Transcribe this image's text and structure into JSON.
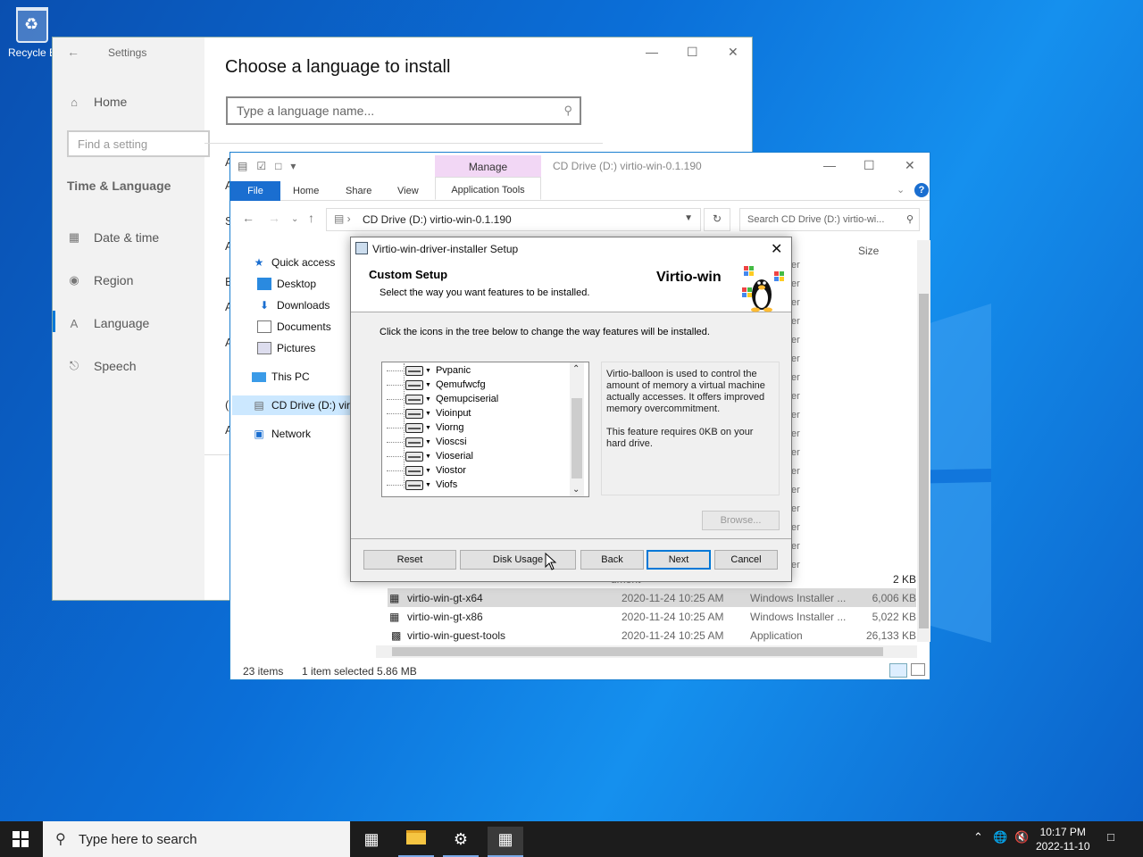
{
  "desktop": {
    "recycle_label": "Recycle B"
  },
  "settings": {
    "title": "Settings",
    "nav": {
      "home": "Home",
      "find_placeholder": "Find a setting",
      "section": "Time & Language",
      "items": [
        "Date & time",
        "Region",
        "Language",
        "Speech"
      ]
    },
    "page_title": "Choose a language to install",
    "search_placeholder": "Type a language name...",
    "edge_letters": [
      "A",
      "A",
      "S",
      "A",
      "E",
      "A",
      "A",
      "(",
      "A"
    ]
  },
  "explorer": {
    "title_path": "CD Drive (D:) virtio-win-0.1.190",
    "manage_label": "Manage",
    "app_tools_label": "Application Tools",
    "tabs": {
      "file": "File",
      "home": "Home",
      "share": "Share",
      "view": "View"
    },
    "address": "CD Drive (D:) virtio-win-0.1.190",
    "search_placeholder": "Search CD Drive (D:) virtio-wi...",
    "nav_tree": [
      {
        "label": "Quick access",
        "icon": "star-icon"
      },
      {
        "label": "Desktop",
        "icon": "desktop-folder-icon"
      },
      {
        "label": "Downloads",
        "icon": "downloads-icon"
      },
      {
        "label": "Documents",
        "icon": "documents-icon"
      },
      {
        "label": "Pictures",
        "icon": "pictures-icon"
      },
      {
        "label": "This PC",
        "icon": "pc-icon"
      },
      {
        "label": "CD Drive (D:) virt",
        "icon": "cd-drive-icon"
      },
      {
        "label": "Network",
        "icon": "network-icon"
      }
    ],
    "column_size": "Size",
    "partial_type_suffix": "er",
    "files": [
      {
        "name": "",
        "date": "",
        "type": "ument",
        "size": "2 KB"
      },
      {
        "name": "virtio-win-gt-x64",
        "date": "2020-11-24 10:25 AM",
        "type": "Windows Installer ...",
        "size": "6,006 KB"
      },
      {
        "name": "virtio-win-gt-x86",
        "date": "2020-11-24 10:25 AM",
        "type": "Windows Installer ...",
        "size": "5,022 KB"
      },
      {
        "name": "virtio-win-guest-tools",
        "date": "2020-11-24 10:25 AM",
        "type": "Application",
        "size": "26,133 KB"
      }
    ],
    "status": {
      "count": "23 items",
      "selection": "1 item selected  5.86 MB"
    }
  },
  "installer": {
    "title": "Virtio-win-driver-installer Setup",
    "heading": "Custom Setup",
    "subheading": "Select the way you want features to be installed.",
    "brand": "Virtio-win",
    "instruction": "Click the icons in the tree below to change the way features will be installed.",
    "features": [
      "Pvpanic",
      "Qemufwcfg",
      "Qemupciserial",
      "Vioinput",
      "Viorng",
      "Vioscsi",
      "Vioserial",
      "Viostor",
      "Viofs"
    ],
    "description": "Virtio-balloon is used to control the amount of memory a virtual machine actually accesses. It offers improved memory overcommitment.",
    "requirement": "This feature requires 0KB on your hard drive.",
    "buttons": {
      "browse": "Browse...",
      "reset": "Reset",
      "disk_usage": "Disk Usage",
      "back": "Back",
      "next": "Next",
      "cancel": "Cancel"
    }
  },
  "taskbar": {
    "search_placeholder": "Type here to search",
    "time": "10:17 PM",
    "date": "2022-11-10"
  }
}
